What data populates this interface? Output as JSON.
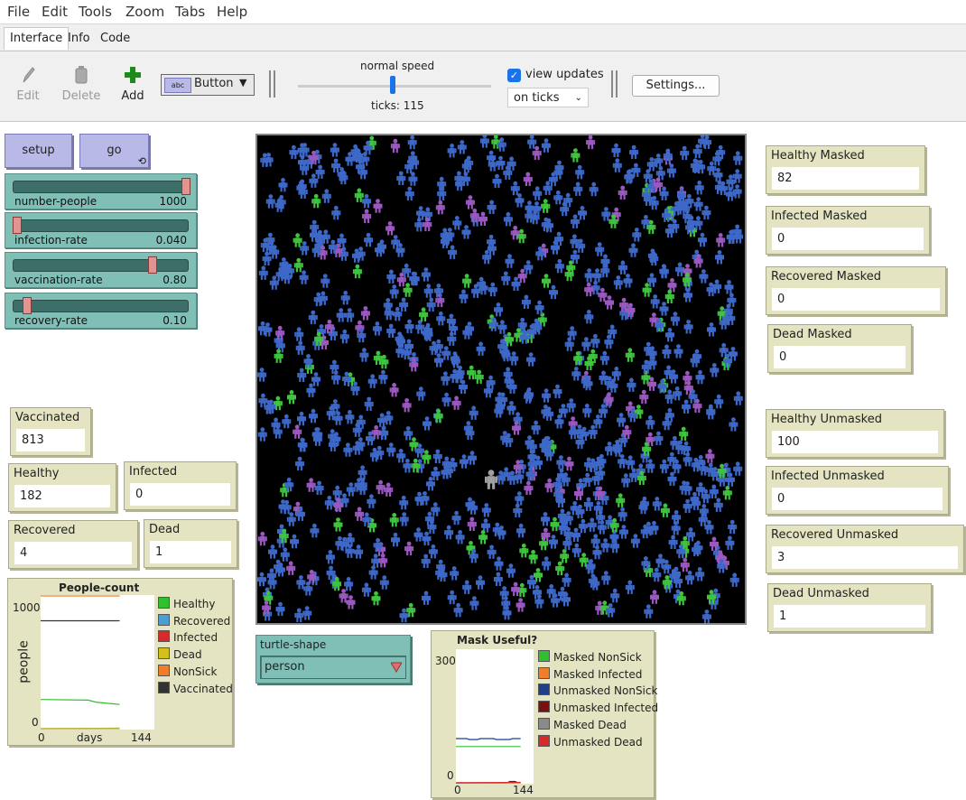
{
  "menu": [
    "File",
    "Edit",
    "Tools",
    "Zoom",
    "Tabs",
    "Help"
  ],
  "tabs": [
    "Interface",
    "Info",
    "Code"
  ],
  "toolbar": {
    "edit": "Edit",
    "delete": "Delete",
    "add": "Add",
    "widget_type": "Button",
    "speed_label": "normal speed",
    "ticks": "ticks: 115",
    "view_updates": "view updates",
    "update_mode": "on ticks",
    "settings": "Settings..."
  },
  "buttons": {
    "setup": "setup",
    "go": "go"
  },
  "sliders": [
    {
      "name": "number-people",
      "value": "1000",
      "fraction": 1.0
    },
    {
      "name": "infection-rate",
      "value": "0.040",
      "fraction": 0.0
    },
    {
      "name": "vaccination-rate",
      "value": "0.80",
      "fraction": 0.8
    },
    {
      "name": "recovery-rate",
      "value": "0.10",
      "fraction": 0.06
    }
  ],
  "monitors": {
    "vaccinated": {
      "label": "Vaccinated",
      "value": "813"
    },
    "healthy": {
      "label": "Healthy",
      "value": "182"
    },
    "infected": {
      "label": "Infected",
      "value": "0"
    },
    "recovered": {
      "label": "Recovered",
      "value": "4"
    },
    "dead": {
      "label": "Dead",
      "value": "1"
    },
    "healthy_masked": {
      "label": "Healthy Masked",
      "value": "82"
    },
    "infected_masked": {
      "label": "Infected Masked",
      "value": "0"
    },
    "recovered_masked": {
      "label": "Recovered Masked",
      "value": "0"
    },
    "dead_masked": {
      "label": "Dead Masked",
      "value": "0"
    },
    "healthy_unmasked": {
      "label": "Healthy Unmasked",
      "value": "100"
    },
    "infected_unmasked": {
      "label": "Infected Unmasked",
      "value": "0"
    },
    "recovered_unmasked": {
      "label": "Recovered Unmasked",
      "value": "3"
    },
    "dead_unmasked": {
      "label": "Dead Unmasked",
      "value": "1"
    }
  },
  "chooser": {
    "label": "turtle-shape",
    "value": "person"
  },
  "world": {
    "agent_colors": [
      "#3d68c8",
      "#9a58c0",
      "#3ec43e",
      "#a0a0a0"
    ]
  },
  "plots": {
    "people_count": {
      "title": "People-count",
      "ylabel": "people",
      "xlabel": "days",
      "ymax": "1000",
      "ymin": "0",
      "xmin": "0",
      "xmax": "144",
      "legend": [
        {
          "name": "Healthy",
          "color": "#2ec02e"
        },
        {
          "name": "Recovered",
          "color": "#4a9fd1"
        },
        {
          "name": "Infected",
          "color": "#d62b2b"
        },
        {
          "name": "Dead",
          "color": "#d2c11a"
        },
        {
          "name": "NonSick",
          "color": "#f07d2a"
        },
        {
          "name": "Vaccinated",
          "color": "#333333"
        }
      ]
    },
    "mask_useful": {
      "title": "Mask Useful?",
      "ymax": "300",
      "ymin": "0",
      "xmin": "0",
      "xmax": "144",
      "legend": [
        {
          "name": "Masked NonSick",
          "color": "#2ec02e"
        },
        {
          "name": "Masked Infected",
          "color": "#f07d2a"
        },
        {
          "name": "Unmasked NonSick",
          "color": "#1f3f8c"
        },
        {
          "name": "Unmasked Infected",
          "color": "#7a1010"
        },
        {
          "name": "Masked Dead",
          "color": "#8a8a8a"
        },
        {
          "name": "Unmasked Dead",
          "color": "#d62b2b"
        }
      ]
    }
  },
  "chart_data": [
    {
      "type": "line",
      "title": "People-count",
      "xlabel": "days",
      "ylabel": "people",
      "xlim": [
        0,
        144
      ],
      "ylim": [
        0,
        1000
      ],
      "series": [
        {
          "name": "Healthy",
          "x": [
            0,
            60,
            70,
            100
          ],
          "y": [
            220,
            215,
            200,
            182
          ]
        },
        {
          "name": "Recovered",
          "x": [
            0,
            100
          ],
          "y": [
            0,
            4
          ]
        },
        {
          "name": "Infected",
          "x": [
            0,
            100
          ],
          "y": [
            0,
            0
          ]
        },
        {
          "name": "Dead",
          "x": [
            0,
            100
          ],
          "y": [
            0,
            1
          ]
        },
        {
          "name": "NonSick",
          "x": [
            0,
            100
          ],
          "y": [
            1000,
            1000
          ]
        },
        {
          "name": "Vaccinated",
          "x": [
            0,
            100
          ],
          "y": [
            813,
            813
          ]
        }
      ]
    },
    {
      "type": "line",
      "title": "Mask Useful?",
      "xlim": [
        0,
        144
      ],
      "ylim": [
        0,
        300
      ],
      "series": [
        {
          "name": "Masked NonSick",
          "x": [
            0,
            120
          ],
          "y": [
            82,
            82
          ]
        },
        {
          "name": "Masked Infected",
          "x": [
            0,
            120
          ],
          "y": [
            0,
            0
          ]
        },
        {
          "name": "Unmasked NonSick",
          "x": [
            0,
            20,
            25,
            40,
            45,
            70,
            75,
            100,
            105,
            120
          ],
          "y": [
            100,
            100,
            98,
            98,
            100,
            100,
            98,
            98,
            100,
            100
          ]
        },
        {
          "name": "Unmasked Infected",
          "x": [
            0,
            95,
            100,
            110,
            115
          ],
          "y": [
            0,
            0,
            3,
            3,
            0
          ]
        },
        {
          "name": "Masked Dead",
          "x": [
            0,
            120
          ],
          "y": [
            0,
            0
          ]
        },
        {
          "name": "Unmasked Dead",
          "x": [
            0,
            120
          ],
          "y": [
            0,
            1
          ]
        }
      ]
    }
  ]
}
